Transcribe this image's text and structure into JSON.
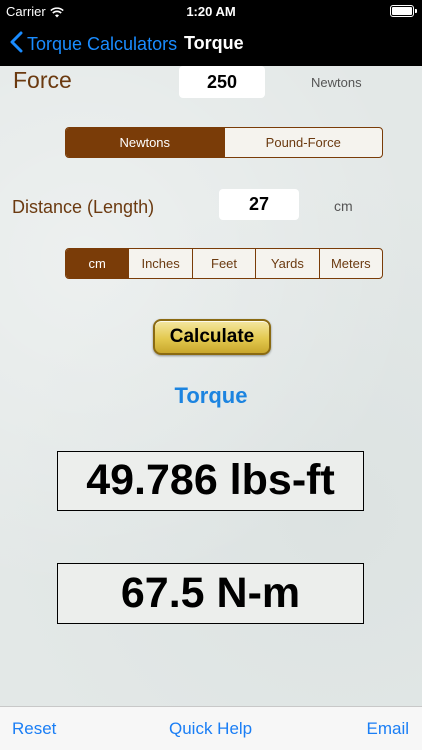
{
  "status_bar": {
    "carrier": "Carrier",
    "time": "1:20 AM",
    "wifi_icon": "wifi-icon",
    "battery_icon": "battery-icon"
  },
  "nav": {
    "back_label": "Torque Calculators",
    "title": "Torque",
    "back_icon": "chevron-left-icon"
  },
  "force": {
    "label": "Force",
    "value": "250",
    "unit": "Newtons",
    "options": [
      "Newtons",
      "Pound-Force"
    ],
    "selected": "Newtons"
  },
  "distance": {
    "label": "Distance (Length)",
    "value": "27",
    "unit": "cm",
    "options": [
      "cm",
      "Inches",
      "Feet",
      "Yards",
      "Meters"
    ],
    "selected": "cm"
  },
  "calculate_label": "Calculate",
  "result": {
    "heading": "Torque",
    "lbs_ft": "49.786 lbs-ft",
    "n_m": "67.5 N-m"
  },
  "toolbar": {
    "reset": "Reset",
    "quick_help": "Quick Help",
    "email": "Email"
  },
  "colors": {
    "accent_brown": "#7a3c08",
    "link_blue": "#1a7ef5",
    "torque_blue": "#1c84e0",
    "button_gold": "#e3c94f"
  }
}
